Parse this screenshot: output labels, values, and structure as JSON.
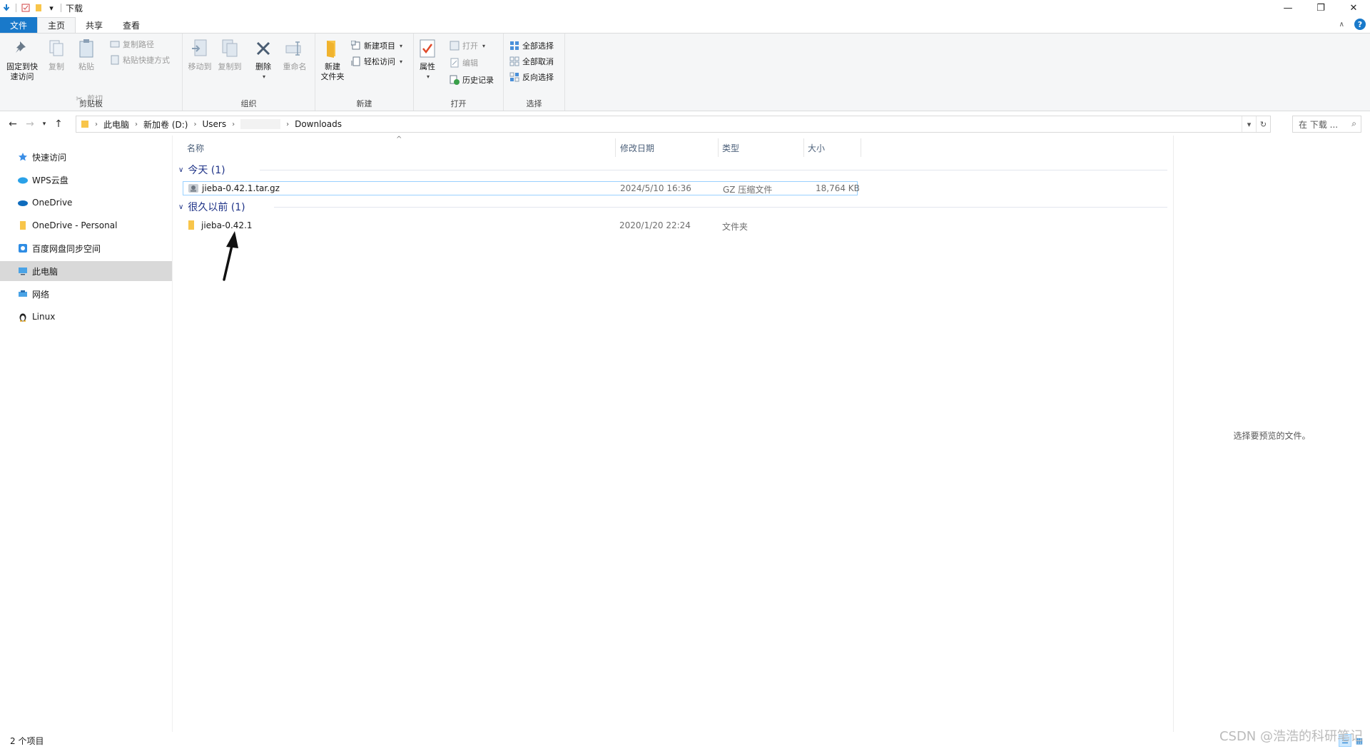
{
  "window": {
    "title": "下载",
    "controls": {
      "minimize": "—",
      "restore": "❐",
      "close": "✕"
    }
  },
  "ribbon_tabs": [
    {
      "label": "文件"
    },
    {
      "label": "主页"
    },
    {
      "label": "共享"
    },
    {
      "label": "查看"
    }
  ],
  "help_label": "?",
  "ribbon": {
    "clipboard": {
      "label": "剪贴板",
      "pin": "固定到快\n速访问",
      "copy": "复制",
      "paste": "粘贴",
      "copy_path": "复制路径",
      "paste_shortcut": "粘贴快捷方式",
      "cut": "剪切"
    },
    "organize": {
      "label": "组织",
      "move_to": "移动到",
      "copy_to": "复制到",
      "delete": "删除",
      "rename": "重命名"
    },
    "new": {
      "label": "新建",
      "new_folder": "新建\n文件夹",
      "new_item": "新建项目",
      "easy_access": "轻松访问"
    },
    "open": {
      "label": "打开",
      "properties": "属性",
      "open": "打开",
      "edit": "编辑",
      "history": "历史记录"
    },
    "select": {
      "label": "选择",
      "select_all": "全部选择",
      "select_none": "全部取消",
      "invert": "反向选择"
    }
  },
  "address": {
    "crumbs": [
      "此电脑",
      "新加卷 (D:)",
      "Users",
      "",
      "Downloads"
    ],
    "search_placeholder": "在 下载 ..."
  },
  "nav": [
    {
      "label": "快速访问",
      "icon": "star-icon"
    },
    {
      "label": "WPS云盘",
      "icon": "cloud-icon"
    },
    {
      "label": "OneDrive",
      "icon": "onedrive-icon"
    },
    {
      "label": "OneDrive - Personal",
      "icon": "folder-icon"
    },
    {
      "label": "百度网盘同步空间",
      "icon": "baidu-icon"
    },
    {
      "label": "此电脑",
      "icon": "computer-icon",
      "selected": true
    },
    {
      "label": "网络",
      "icon": "network-icon"
    },
    {
      "label": "Linux",
      "icon": "penguin-icon"
    }
  ],
  "columns": {
    "name": "名称",
    "modified": "修改日期",
    "type": "类型",
    "size": "大小"
  },
  "groups": [
    {
      "title": "今天 (1)",
      "items": [
        {
          "name": "jieba-0.42.1.tar.gz",
          "modified": "2024/5/10 16:36",
          "type": "GZ 压缩文件",
          "size": "18,764 KB",
          "icon": "archive-icon"
        }
      ]
    },
    {
      "title": "很久以前 (1)",
      "items": [
        {
          "name": "jieba-0.42.1",
          "modified": "2020/1/20 22:24",
          "type": "文件夹",
          "size": "",
          "icon": "folder-icon"
        }
      ]
    }
  ],
  "preview_message": "选择要预览的文件。",
  "status": {
    "count": "2 个项目"
  },
  "watermark": "CSDN @浩浩的科研笔记",
  "colors": {
    "accent": "#1979ca",
    "group_header": "#1e3287",
    "folder": "#f8c54a"
  }
}
